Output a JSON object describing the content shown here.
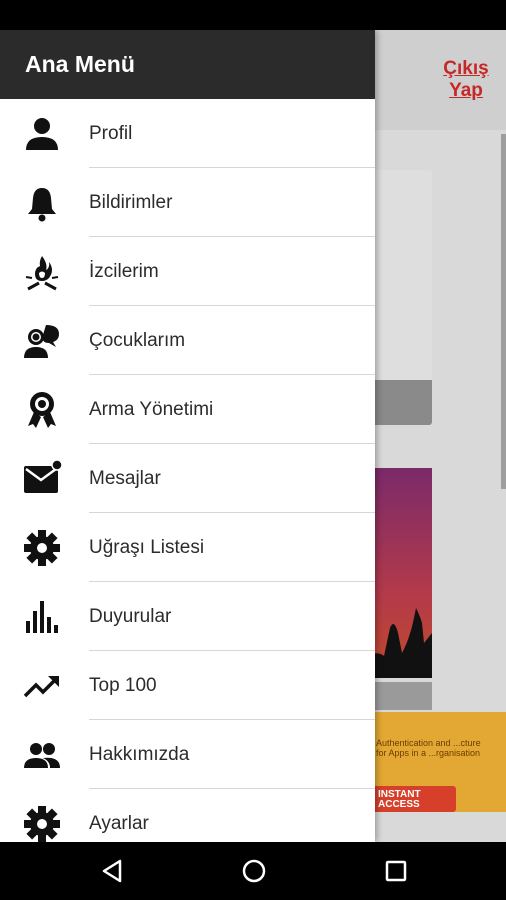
{
  "drawer": {
    "title": "Ana Menü",
    "items": [
      {
        "label": "Profil",
        "icon": "person-icon"
      },
      {
        "label": "Bildirimler",
        "icon": "bell-icon"
      },
      {
        "label": "İzcilerim",
        "icon": "campfire-icon"
      },
      {
        "label": "Çocuklarım",
        "icon": "chat-people-icon"
      },
      {
        "label": "Arma Yönetimi",
        "icon": "badge-icon"
      },
      {
        "label": "Mesajlar",
        "icon": "mail-icon"
      },
      {
        "label": "Uğraşı Listesi",
        "icon": "gear-icon"
      },
      {
        "label": "Duyurular",
        "icon": "bar-chart-icon"
      },
      {
        "label": "Top 100",
        "icon": "trending-up-icon"
      },
      {
        "label": "Hakkımızda",
        "icon": "people-icon"
      },
      {
        "label": "Ayarlar",
        "icon": "settings-icon"
      }
    ]
  },
  "background": {
    "logout_label": "Çıkış Yap",
    "ad_text": "Authentication and ...cture for Apps in a ...rganisation",
    "ad_button": "INSTANT ACCESS"
  },
  "colors": {
    "drawer_header": "#2b2b2b",
    "logout_text": "#c62828",
    "ad_background": "#e3a833",
    "ad_button": "#d6402b"
  }
}
